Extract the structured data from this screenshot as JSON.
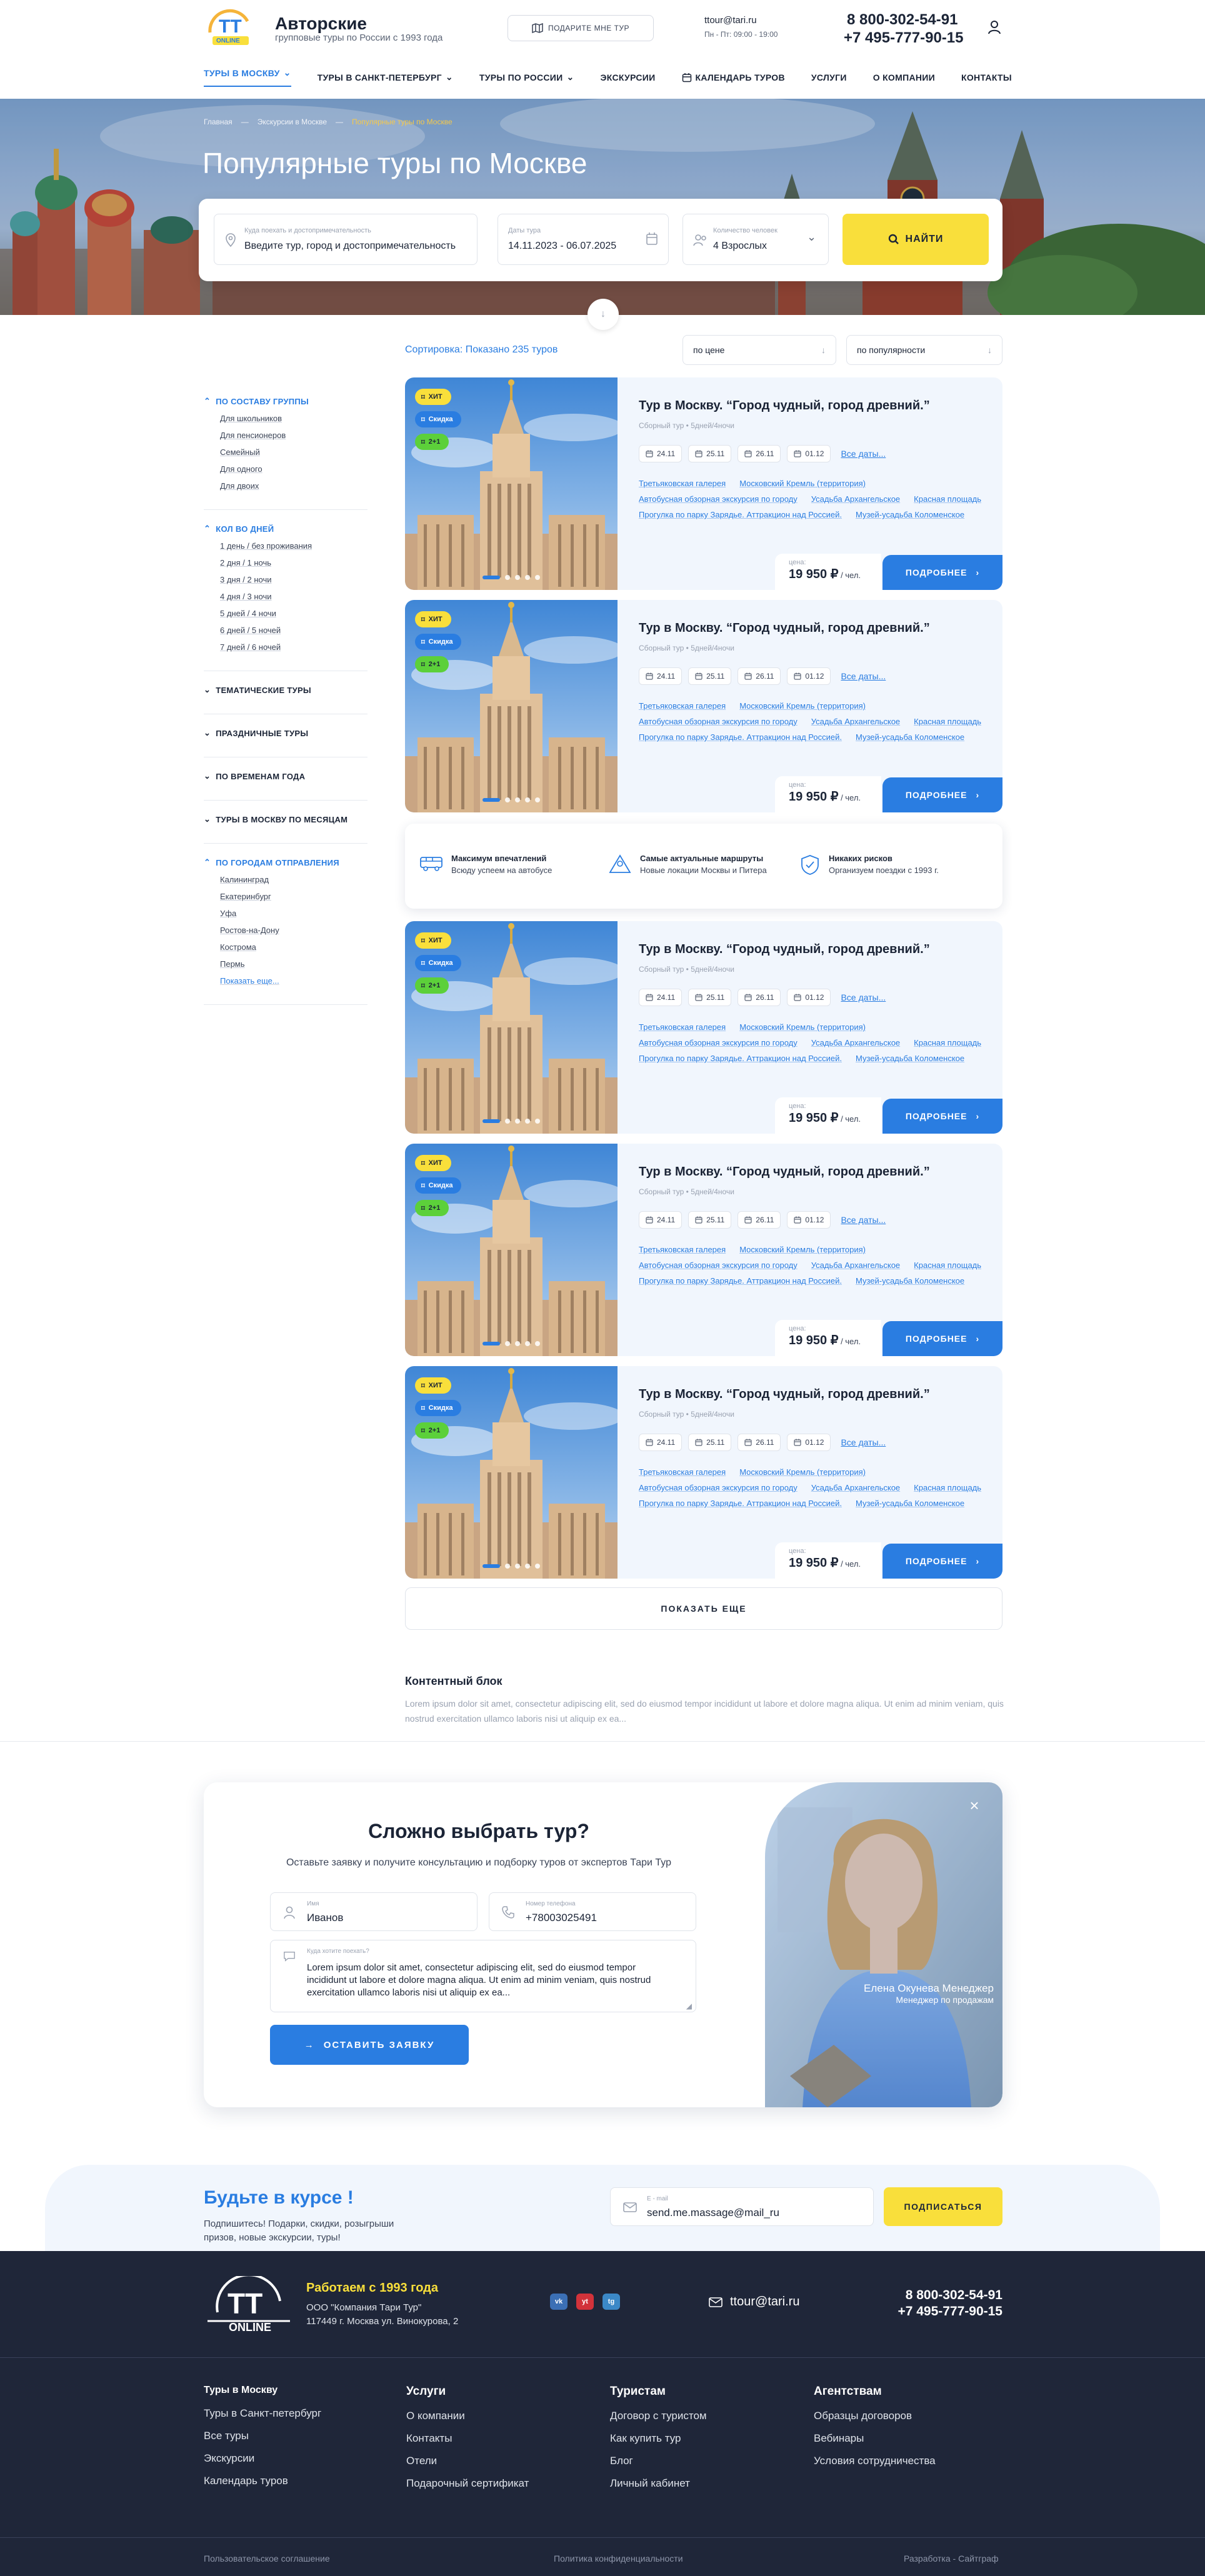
{
  "header": {
    "brand_title": "Авторские",
    "brand_subtitle": "групповые туры по России с 1993 года",
    "logo_text": "ONLINE",
    "recommend_label": "ПОДАРИТЕ МНЕ ТУР",
    "email": "ttour@tari.ru",
    "hours": "Пн - Пт: 09:00 - 19:00",
    "phone1": "8 800-302-54-91",
    "phone2": "+7 495-777-90-15"
  },
  "nav": [
    {
      "label": "ТУРЫ В МОСКВУ",
      "active": true,
      "caret": true
    },
    {
      "label": "ТУРЫ В САНКТ-ПЕТЕРБУРГ",
      "caret": true
    },
    {
      "label": "ТУРЫ ПО РОССИИ",
      "caret": true
    },
    {
      "label": "ЭКСКУРСИИ"
    },
    {
      "label": "КАЛЕНДАРЬ ТУРОВ",
      "icon": true
    },
    {
      "label": "УСЛУГИ"
    },
    {
      "label": "О КОМПАНИИ"
    },
    {
      "label": "КОНТАКТЫ"
    }
  ],
  "hero": {
    "breadcrumbs": [
      "Главная",
      "Экскурсии в Москве",
      "Популярные туры по Москве"
    ],
    "title": "Популярные туры по Москве"
  },
  "search": {
    "dest_label": "Куда поехать и достопримечательность",
    "dest_value": "Введите тур, город и достопримечательность",
    "date_label": "Даты тура",
    "date_value": "14.11.2023 - 06.07.2025",
    "guests_label": "Количество человек",
    "guests_value": "4 Взрослых",
    "find_label": "НАЙТИ"
  },
  "sorting": {
    "label": "Сортировка:",
    "count": "Показано 235 туров",
    "sel1": "по цене",
    "sel2": "по популярности"
  },
  "sidebar": [
    {
      "title": "ПО СОСТАВУ ГРУППЫ",
      "open": true,
      "items": [
        "Для школьников",
        "Для пенсионеров",
        "Семейный",
        "Для одного",
        "Для двоих"
      ]
    },
    {
      "title": "КОЛ ВО ДНЕЙ",
      "open": true,
      "items": [
        "1 день / без проживания",
        "2 дня / 1 ночь",
        "3 дня / 2 ночи",
        "4 дня / 3 ночи",
        "5 дней / 4 ночи",
        "6 дней / 5 ночей",
        "7 дней / 6 ночей"
      ]
    },
    {
      "title": "ТЕМАТИЧЕСКИЕ ТУРЫ",
      "open": false,
      "items": []
    },
    {
      "title": "ПРАЗДНИЧНЫЕ ТУРЫ",
      "open": false,
      "items": []
    },
    {
      "title": "ПО ВРЕМЕНАМ ГОДА",
      "open": false,
      "items": []
    },
    {
      "title": "ТУРЫ В МОСКВУ ПО МЕСЯЦАМ",
      "open": false,
      "items": []
    },
    {
      "title": "ПО ГОРОДАМ ОТПРАВЛЕНИЯ",
      "open": true,
      "items": [
        "Калининград",
        "Екатеринбург",
        "Уфа",
        "Ростов-на-Дону",
        "Кострома",
        "Пермь"
      ],
      "more": "Показать еще..."
    }
  ],
  "tour": {
    "badges": [
      "ХИТ",
      "Скидка",
      "2+1"
    ],
    "title": "Тур в Москву. “Город чудный, город древний.”",
    "subtitle": "Сборный тур  •  5дней/4ночи",
    "dates": [
      "24.11",
      "25.11",
      "26.11",
      "01.12"
    ],
    "all_dates": "Все даты...",
    "tags": [
      "Третьяковская галерея",
      "Московский Кремль (территория)",
      "Автобусная обзорная экскурсия по городу",
      "Усадьба Архангельское",
      "Красная площадь",
      "Прогулка по парку Зарядье. Аттракцион над Россией.",
      "Музей-усадьба Коломенское"
    ],
    "price_label": "цена:",
    "price": "19 950 ₽",
    "price_unit": " / чел.",
    "more_label": "ПОДРОБНЕЕ"
  },
  "features": [
    {
      "title": "Максимум впечатлений",
      "desc": "Всюду успеем на автобусе"
    },
    {
      "title": "Самые актуальные маршруты",
      "desc": "Новые локации Москвы и Питера"
    },
    {
      "title": "Никаких рисков",
      "desc": "Организуем поездки с 1993 г."
    }
  ],
  "show_more": "ПОКАЗАТЬ ЕЩЕ",
  "content_block": {
    "title": "Контентный блок",
    "text": "Lorem ipsum dolor sit amet, consectetur adipiscing elit, sed do eiusmod tempor incididunt ut labore et dolore magna aliqua. Ut enim ad minim veniam, quis nostrud exercitation ullamco laboris nisi ut aliquip ex ea..."
  },
  "consult": {
    "title": "Сложно выбрать тур?",
    "subtitle": "Оставьте заявку и получите консультацию и подборку туров от экспертов Тари Тур",
    "name_label": "Имя",
    "name_value": "Иванов",
    "phone_label": "Номер телефона",
    "phone_value": "+78003025491",
    "q_label": "Куда хотите поехать?",
    "q_value": "Lorem ipsum dolor sit amet, consectetur adipiscing elit, sed do eiusmod tempor incididunt ut labore et dolore magna aliqua. Ut enim ad minim veniam, quis nostrud exercitation ullamco laboris nisi ut aliquip ex ea...",
    "send_label": "ОСТАВИТЬ ЗАЯВКУ",
    "manager_name": "Елена Окунева Менеджер",
    "manager_role": "Менеджер по продажам"
  },
  "subscribe": {
    "title": "Будьте в курсе !",
    "desc": "Подпишитесь! Подарки, скидки, розыгрыши призов, новые экскурсии, туры!",
    "email_label": "E - mail",
    "email_value": "send.me.massage@mail_ru",
    "btn": "ПОДПИСАТЬСЯ"
  },
  "footer": {
    "since": "Работаем с 1993 года",
    "company": "ООО \"Компания Тари Тур\"",
    "address": "117449 г. Москва ул. Винокурова, 2",
    "social": [
      "vk",
      "yt",
      "tg"
    ],
    "email": "ttour@tari.ru",
    "phone1": "8 800-302-54-91",
    "phone2": "+7 495-777-90-15",
    "columns": [
      {
        "title": "Туры в Москву",
        "items": [
          "Туры в Санкт-петербург",
          "Все туры",
          "Экскурсии",
          "Календарь туров"
        ]
      },
      {
        "title": "Услуги",
        "items": [
          "О компании",
          "Контакты",
          "Отели",
          "Подарочный сертификат"
        ]
      },
      {
        "title": "Туристам",
        "items": [
          "Договор с туристом",
          "Как купить тур",
          "Блог",
          "Личный кабинет"
        ]
      },
      {
        "title": "Агентствам",
        "items": [
          "Образцы договоров",
          "Вебинары",
          "Условия сотрудничества"
        ]
      }
    ],
    "bottom": [
      "Пользовательское соглашение",
      "Политика конфиденциальности",
      "Разработка - Сайтграф"
    ]
  },
  "colors": {
    "accent": "#2a7de1",
    "yellow": "#f9df3b",
    "green": "#5cd03a",
    "footer": "#1f2639"
  }
}
